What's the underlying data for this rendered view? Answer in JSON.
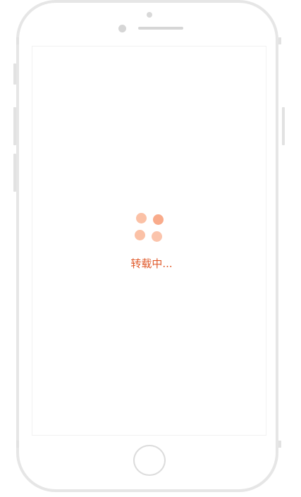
{
  "loading": {
    "text": "转载中...",
    "text_color": "#e05a2b",
    "dot_colors": [
      "#fbc1a6",
      "#f9ab8b",
      "#fbc1a6",
      "#fbc4ac"
    ]
  },
  "device": {
    "frame_color": "#e6e6e6",
    "screen_color": "#ffffff"
  }
}
